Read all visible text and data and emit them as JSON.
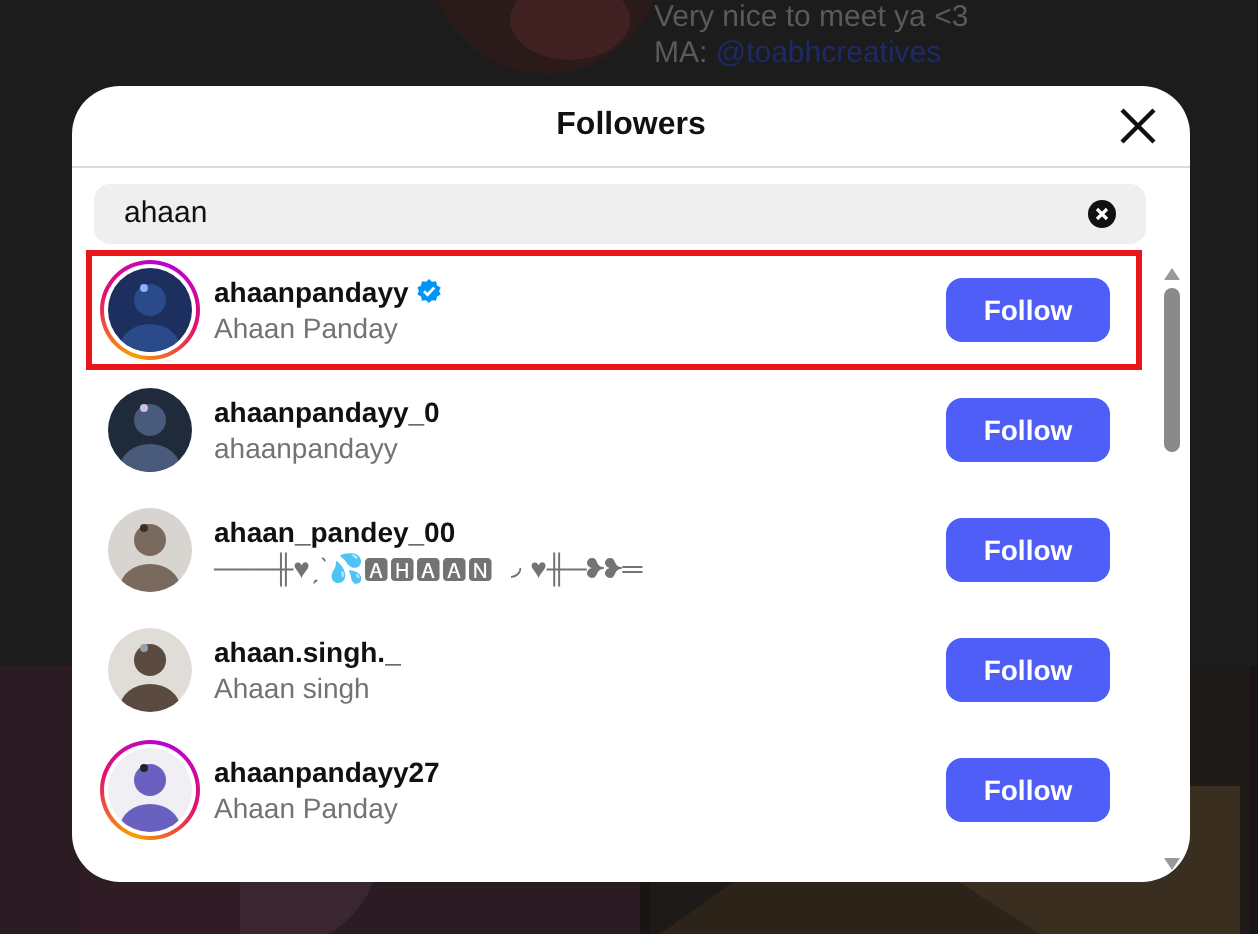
{
  "background": {
    "bio_lines": [
      {
        "text": "Very nice to meet ya <3",
        "kind": "plain"
      },
      {
        "text": "MA: ",
        "link": "@toabhcreatives",
        "kind": "mention"
      }
    ]
  },
  "dialog": {
    "title": "Followers",
    "search": {
      "value": "ahaan"
    },
    "rows": [
      {
        "username": "ahaanpandayy",
        "verified": true,
        "full_name": "Ahaan Panday",
        "story_ring": true,
        "highlighted": true,
        "button": "Follow"
      },
      {
        "username": "ahaanpandayy_0",
        "verified": false,
        "full_name": "ahaanpandayy",
        "story_ring": false,
        "highlighted": false,
        "button": "Follow"
      },
      {
        "username": "ahaan_pandey_00",
        "verified": false,
        "full_name": "───╫♥ˏˋ💦🅰🅷🅰🅰🅽 ◞ ♥╫─❥❥═",
        "story_ring": false,
        "highlighted": false,
        "button": "Follow"
      },
      {
        "username": "ahaan.singh._",
        "verified": false,
        "full_name": "Ahaan singh",
        "story_ring": false,
        "highlighted": false,
        "button": "Follow"
      },
      {
        "username": "ahaanpandayy27",
        "verified": false,
        "full_name": "Ahaan Panday",
        "story_ring": true,
        "highlighted": false,
        "button": "Follow"
      }
    ]
  }
}
